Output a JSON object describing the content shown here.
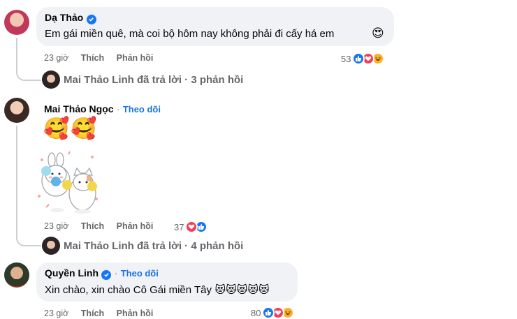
{
  "comments": [
    {
      "author": "Dạ Thảo",
      "text": "Em gái miền quê, mà coi bộ hôm nay không phải đi cấy há em",
      "time": "23 giờ",
      "like_label": "Thích",
      "reply_label": "Phản hồi",
      "reaction_count": "53",
      "reactions": [
        "like-icon",
        "love-icon",
        "haha-icon"
      ],
      "reply_summary": "Mai Thảo Linh đã trả lời · 3 phản hồi"
    },
    {
      "author": "Mai Thảo Ngọc",
      "follow_label": "Theo dõi",
      "sticker_emojis": "🥰🥰",
      "time": "23 giờ",
      "like_label": "Thích",
      "reply_label": "Phản hồi",
      "reaction_count": "37",
      "reactions": [
        "love-icon",
        "like-icon"
      ],
      "reply_summary": "Mai Thảo Linh đã trả lời · 4 phản hồi"
    },
    {
      "author": "Quyền Linh",
      "follow_label": "Theo dõi",
      "text": "Xin chào, xin chào Cô Gái miền Tây",
      "emojis": "😻😻😻😻😻",
      "time": "23 giờ",
      "like_label": "Thích",
      "reply_label": "Phản hồi",
      "reaction_count": "80",
      "reactions": [
        "like-icon",
        "love-icon",
        "haha-icon"
      ]
    }
  ],
  "colors": {
    "bubble": "#f0f2f5",
    "meta": "#65676b",
    "accent": "#1b74e4",
    "like": "#1877f2",
    "love": "#f33e58",
    "haha": "#f7b125"
  }
}
